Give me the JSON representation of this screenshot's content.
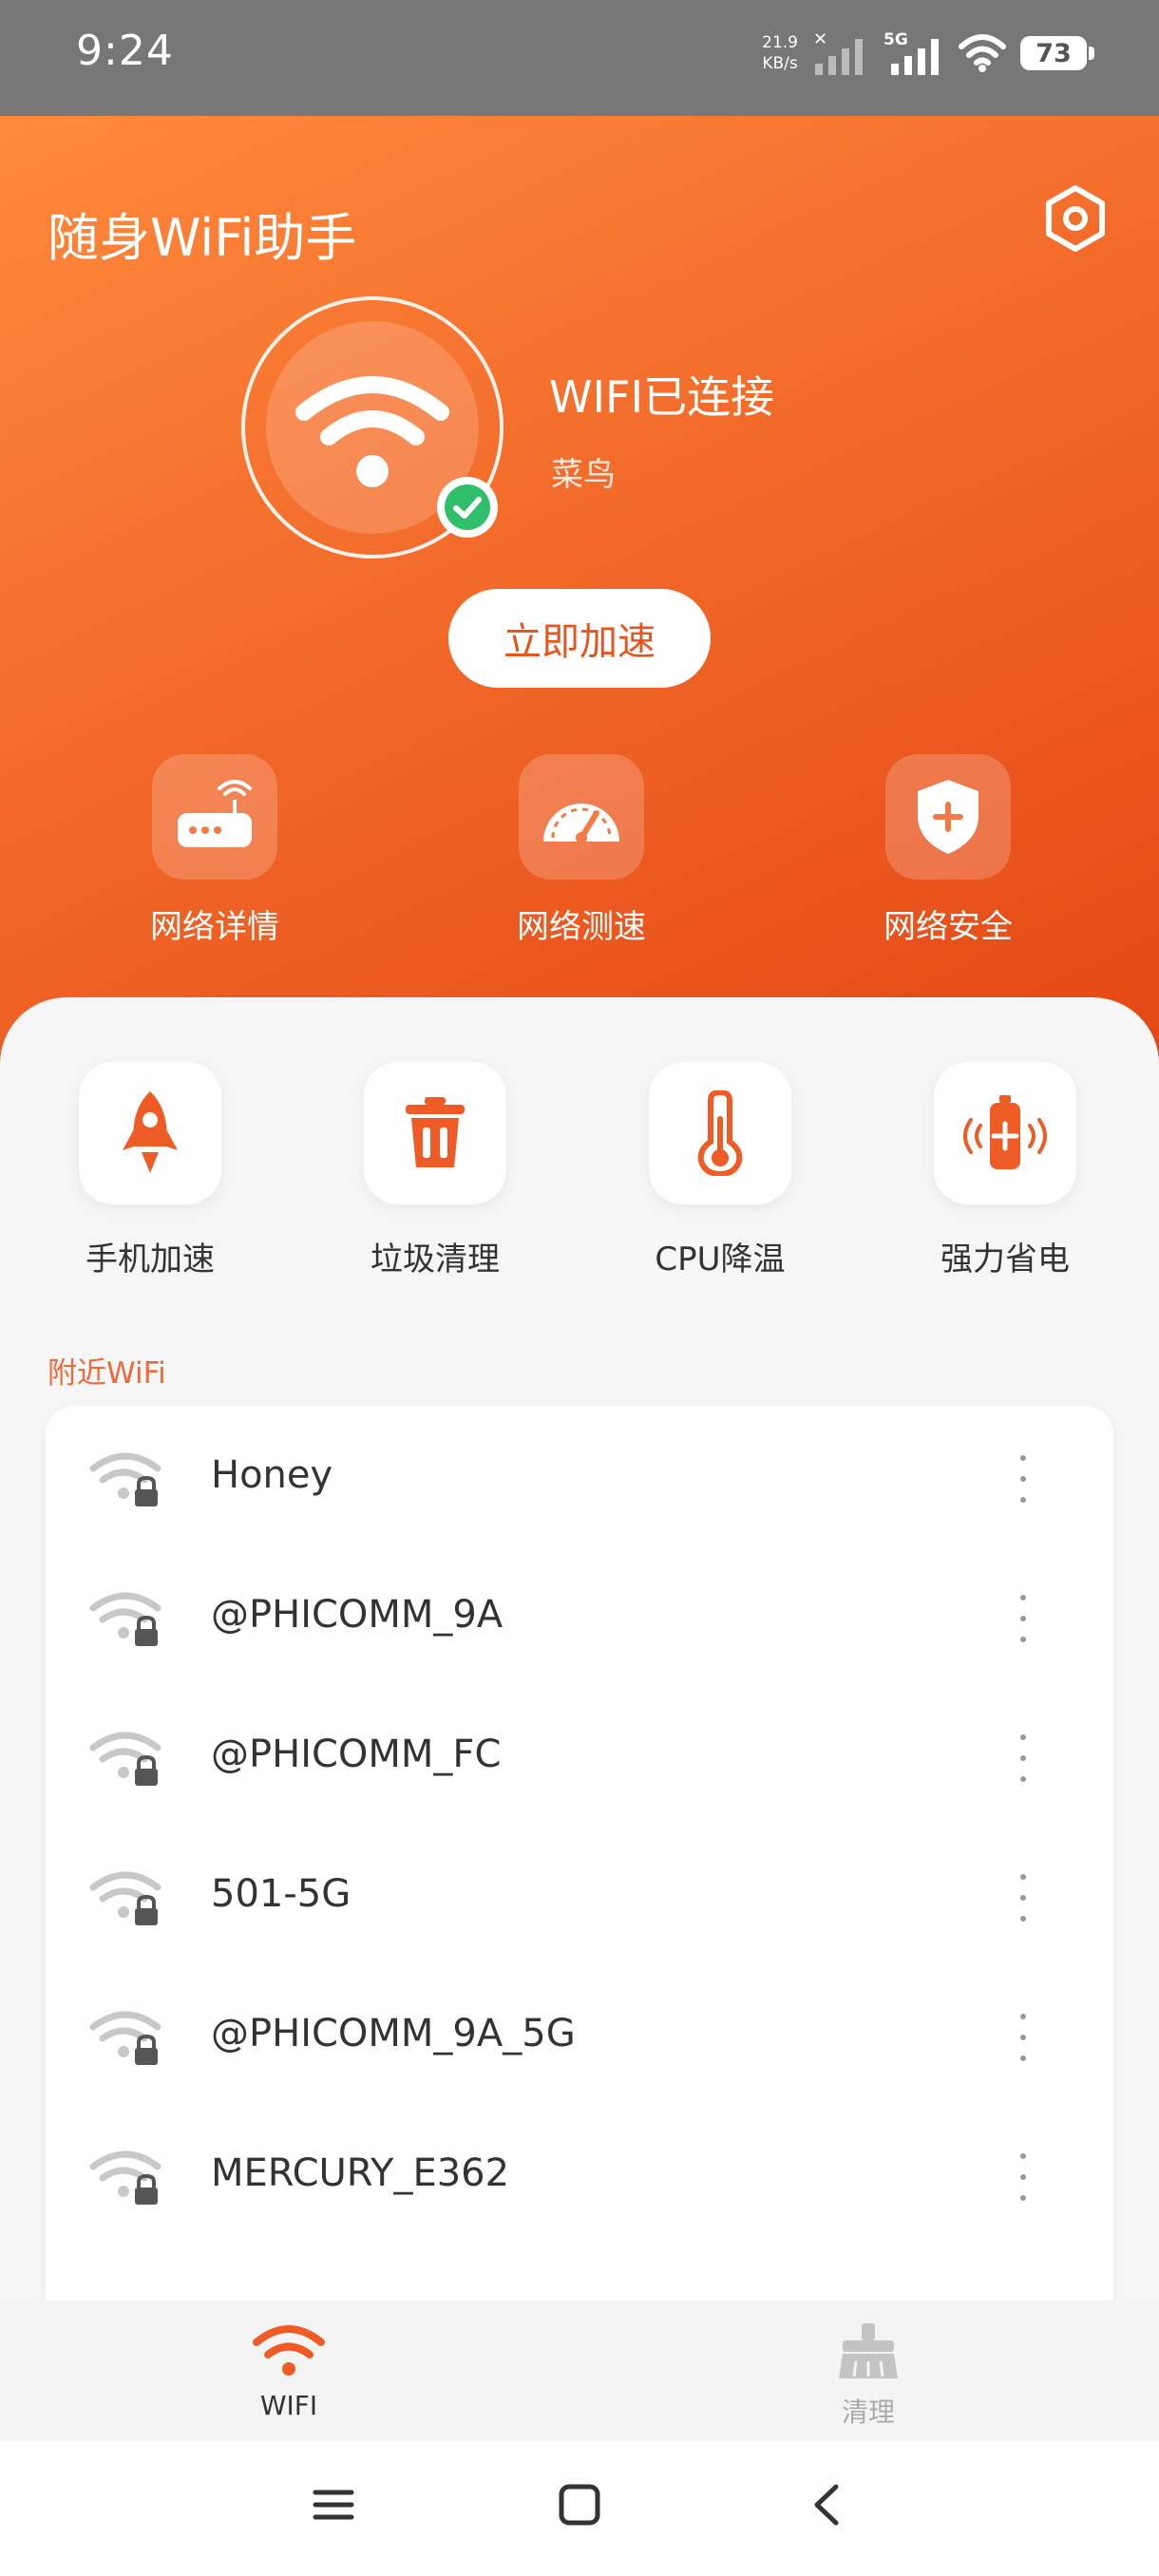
{
  "status_bar": {
    "time": "9:24",
    "net_speed_value": "21.9",
    "net_speed_unit": "KB/s",
    "network_type": "5G",
    "battery": "73"
  },
  "header": {
    "app_title": "随身WiFi助手",
    "connection_status": "WIFI已连接",
    "connected_ssid": "菜鸟",
    "boost_label": "立即加速",
    "tools": [
      {
        "label": "网络详情",
        "icon": "router-icon"
      },
      {
        "label": "网络测速",
        "icon": "speedometer-icon"
      },
      {
        "label": "网络安全",
        "icon": "shield-plus-icon"
      }
    ]
  },
  "features": [
    {
      "label": "手机加速",
      "icon": "rocket-icon"
    },
    {
      "label": "垃圾清理",
      "icon": "trash-icon"
    },
    {
      "label": "CPU降温",
      "icon": "thermometer-icon"
    },
    {
      "label": "强力省电",
      "icon": "battery-plus-icon"
    }
  ],
  "nearby": {
    "title": "附近WiFi",
    "networks": [
      {
        "ssid": "Honey"
      },
      {
        "ssid": "@PHICOMM_9A"
      },
      {
        "ssid": "@PHICOMM_FC"
      },
      {
        "ssid": "501-5G"
      },
      {
        "ssid": "@PHICOMM_9A_5G"
      },
      {
        "ssid": "MERCURY_E362"
      }
    ]
  },
  "bottom_nav": {
    "wifi_label": "WIFI",
    "clean_label": "清理",
    "active": "WIFI"
  },
  "colors": {
    "accent": "#ef5b25",
    "gradient_start": "#ff8a3c",
    "gradient_end": "#e44715",
    "check_green": "#2fbe6a"
  }
}
